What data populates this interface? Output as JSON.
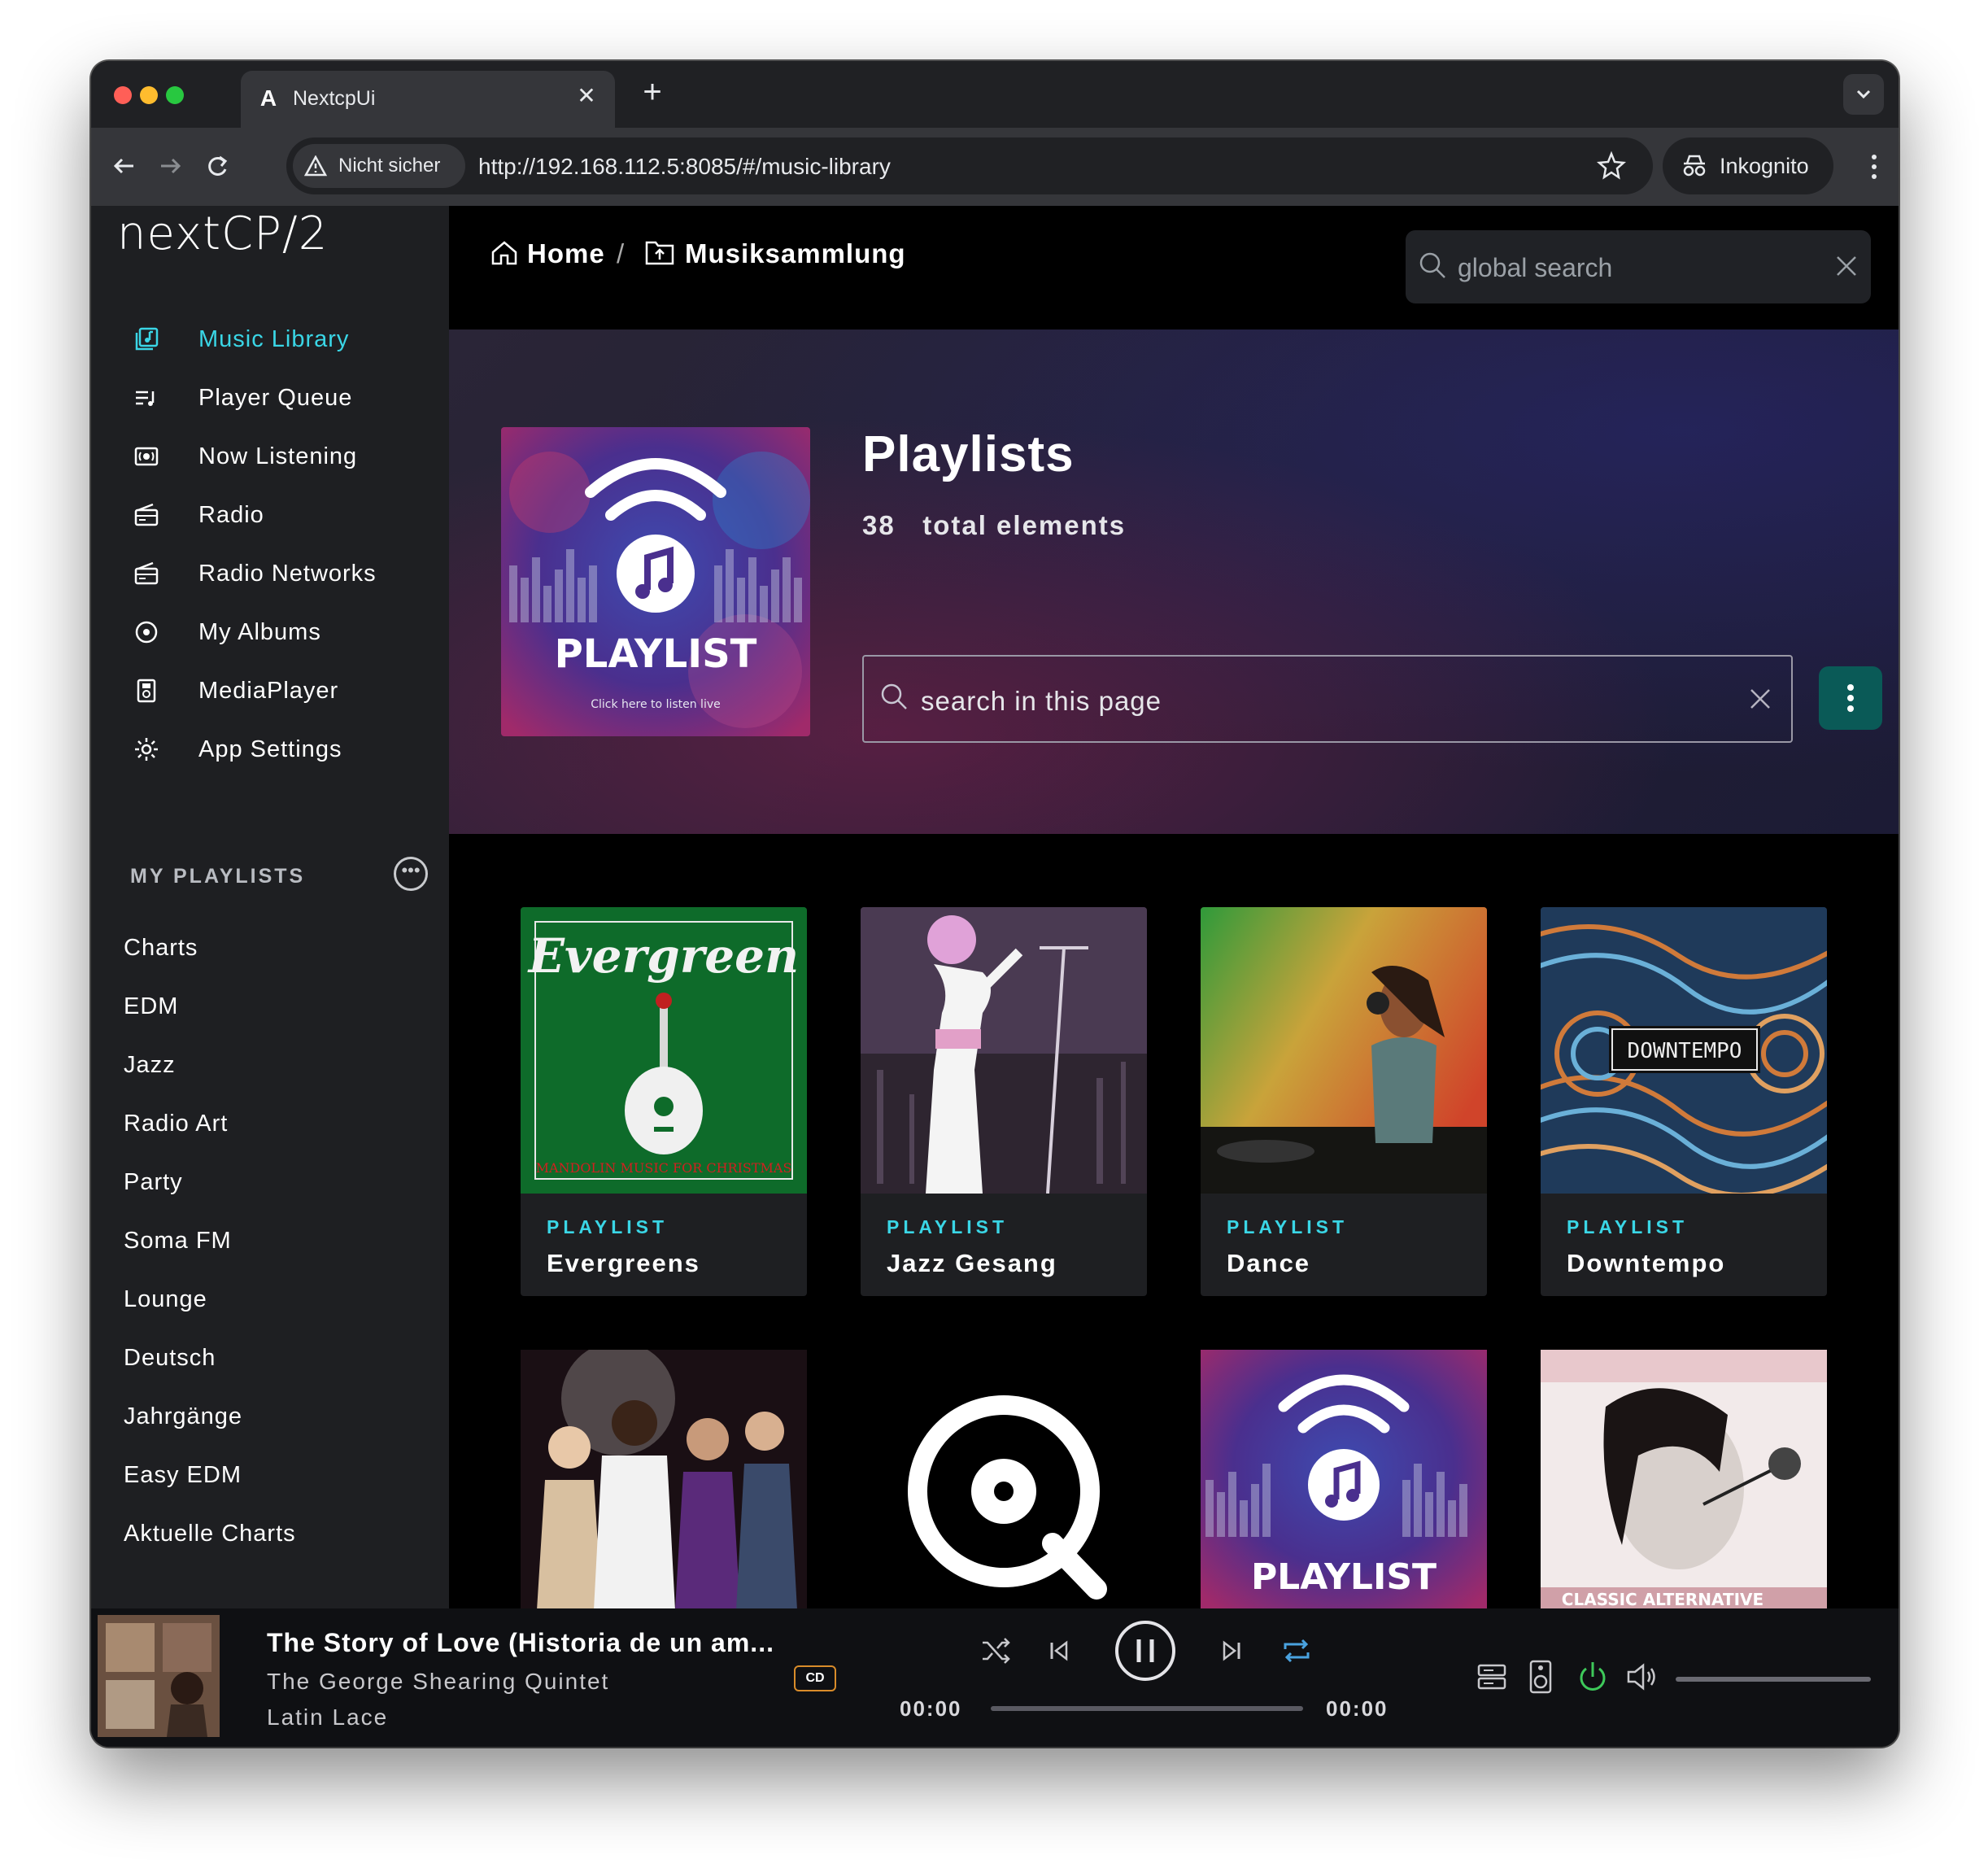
{
  "browser": {
    "tab_title": "NextcpUi",
    "tab_logo": "A",
    "security_label": "Nicht sicher",
    "url": "http://192.168.112.5:8085/#/music-library",
    "incognito_label": "Inkognito",
    "colors": {
      "close": "#ff5f57",
      "minimize": "#febc2e",
      "maximize": "#28c840"
    }
  },
  "app": {
    "brand": "nextCP/2",
    "accent": "#3ad6e6",
    "menu": [
      {
        "label": "Music Library",
        "icon": "music-library-icon",
        "active": true
      },
      {
        "label": "Player Queue",
        "icon": "queue-icon"
      },
      {
        "label": "Now Listening",
        "icon": "now-listening-icon"
      },
      {
        "label": "Radio",
        "icon": "radio-icon"
      },
      {
        "label": "Radio Networks",
        "icon": "radio-networks-icon"
      },
      {
        "label": "My Albums",
        "icon": "album-icon"
      },
      {
        "label": "MediaPlayer",
        "icon": "media-player-icon"
      },
      {
        "label": "App Settings",
        "icon": "settings-icon"
      }
    ],
    "my_playlists": {
      "heading": "MY PLAYLISTS",
      "items": [
        "Charts",
        "EDM",
        "Jazz",
        "Radio Art",
        "Party",
        "Soma FM",
        "Lounge",
        "Deutsch",
        "Jahrgänge",
        "Easy EDM",
        "Aktuelle Charts"
      ]
    }
  },
  "main": {
    "breadcrumb": {
      "home": "Home",
      "separator": "/",
      "current": "Musiksammlung"
    },
    "global_search_placeholder": "global search",
    "hero": {
      "title": "Playlists",
      "count": "38",
      "count_label": "total elements",
      "cover_title": "PLAYLIST",
      "cover_subtitle": "Click here to listen live",
      "page_search_placeholder": "search in this page"
    },
    "cards": [
      {
        "kind": "PLAYLIST",
        "name": "Evergreens",
        "art_title": "Evergreen",
        "art_caption": "MANDOLIN MUSIC FOR CHRISTMAS"
      },
      {
        "kind": "PLAYLIST",
        "name": "Jazz Gesang"
      },
      {
        "kind": "PLAYLIST",
        "name": "Dance"
      },
      {
        "kind": "PLAYLIST",
        "name": "Downtempo",
        "art_title": "DOWNTEMPO"
      }
    ],
    "second_row": [
      {
        "art": "party-photo"
      },
      {
        "art": "qobuz-logo"
      },
      {
        "art": "playlist-radio",
        "art_title": "PLAYLIST"
      },
      {
        "art": "classic-alternative",
        "art_title": "CLASSIC ALTERNATIVE"
      }
    ]
  },
  "player": {
    "title": "The Story of Love (Historia de un am...",
    "artist": "The George Shearing Quintet",
    "album": "Latin Lace",
    "badge": "CD",
    "elapsed": "00:00",
    "duration": "00:00",
    "progress": 0,
    "power_color": "#3ec95a",
    "repeat_color": "#4aa3e0"
  }
}
